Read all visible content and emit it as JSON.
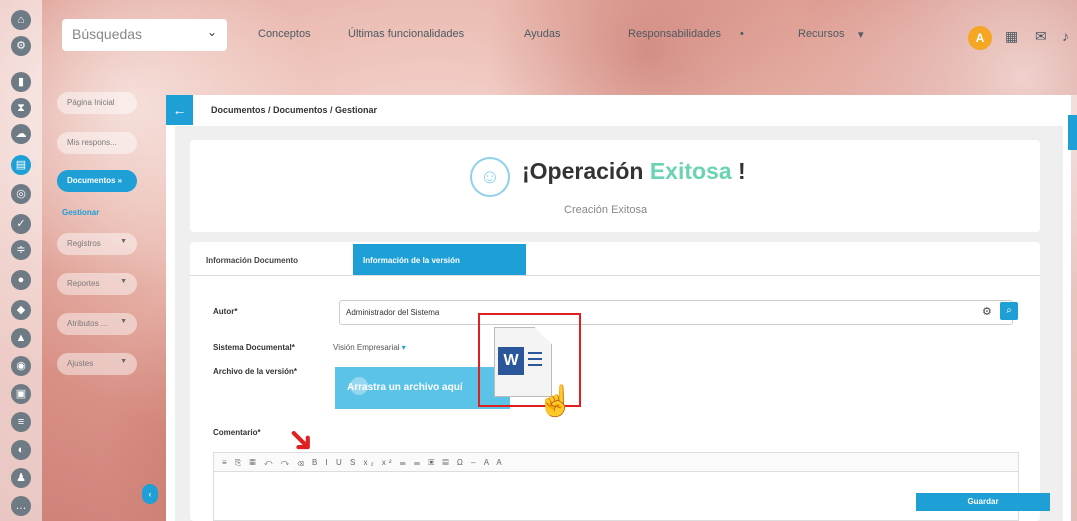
{
  "topbar": {
    "search_label": "Búsquedas",
    "nav": [
      "Conceptos",
      "Últimas funcionalidades",
      "Ayudas",
      "Responsabilidades",
      "Recursos"
    ],
    "avatar_initial": "A"
  },
  "sidebar": {
    "items": [
      {
        "label": "Página Inicial"
      },
      {
        "label": "Mis respons..."
      },
      {
        "label": "Documentos »"
      },
      {
        "label": "Registros"
      },
      {
        "label": "Reportes"
      },
      {
        "label": "Atributos ..."
      },
      {
        "label": "Ajustes"
      }
    ],
    "sub_active": "Gestionar"
  },
  "breadcrumb": "Documentos / Documentos / Gestionar",
  "success": {
    "title_prefix": "¡Operación ",
    "title_accent": "Exitosa",
    "title_suffix": " !",
    "subtitle": "Creación Exitosa"
  },
  "tabs": [
    "Información Documento",
    "Información de la versión"
  ],
  "form": {
    "autor_label": "Autor*",
    "autor_value": "Administrador del Sistema",
    "sistema_label": "Sistema Documental*",
    "sistema_value": "Visión Empresarial",
    "archivo_label": "Archivo de la versión*",
    "drop_text": "Arrastra un archivo aquí",
    "comentario_label": "Comentario*",
    "toolbar_glyphs": "≡ ⎘ ▦ ↶ ↷ ⌫ B I U S x₂ x² ☰ ☰ ▣ ▤ Ω – A A",
    "save_label": "Guardar"
  },
  "colors": {
    "accent": "#1e9fd6",
    "success_accent": "#6ad3b4",
    "highlight": "#e02020"
  }
}
